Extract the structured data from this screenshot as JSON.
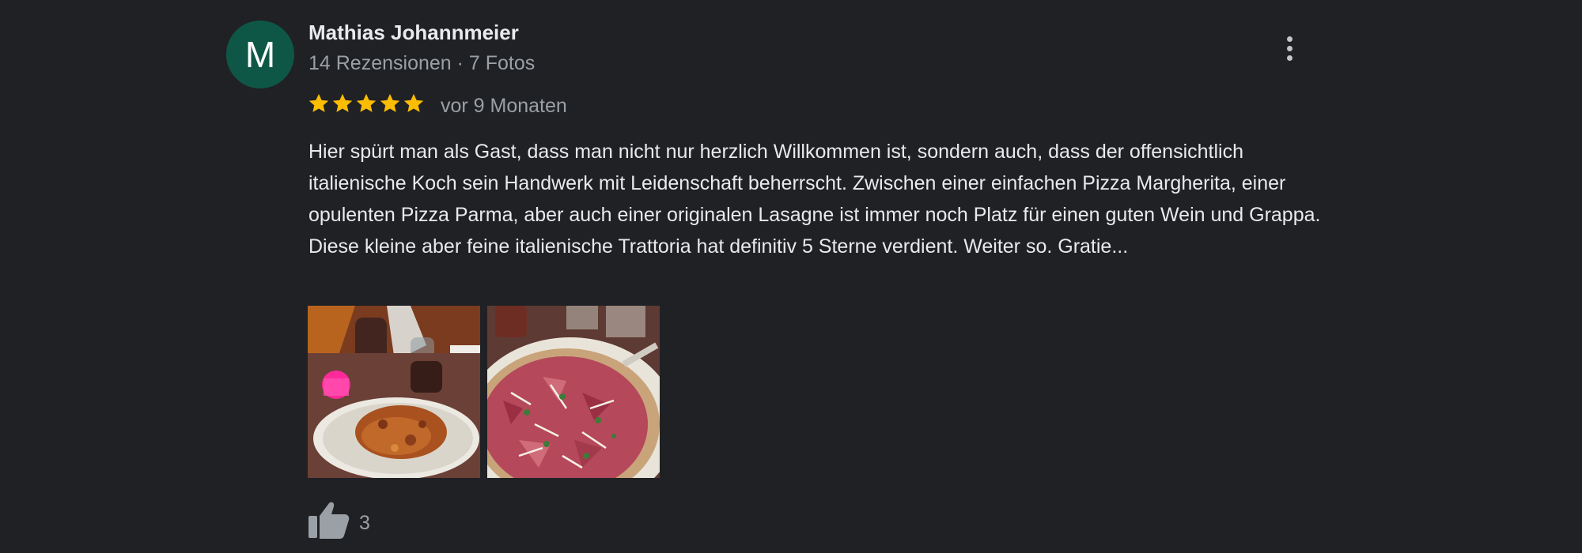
{
  "review": {
    "avatar_letter": "M",
    "author": "Mathias Johannmeier",
    "meta": "14 Rezensionen · 7 Fotos",
    "rating": 5,
    "time": "vor 9 Monaten",
    "text_lines": [
      "Hier spürt man als Gast, dass man nicht nur herzlich Willkommen ist, sondern auch, dass der offensichtlich italienische Koch sein Handwerk mit Leidenschaft beherrscht. Zwischen einer einfachen Pizza Margherita, einer opulenten Pizza Parma, aber auch einer originalen Lasagne ist immer noch Platz für einen guten Wein und Grappa.",
      "Diese kleine aber feine italienische Trattoria hat definitiv 5 Sterne verdient. Weiter so. Gratie..."
    ],
    "photos": [
      {
        "subject": "lasagne-plate-photo"
      },
      {
        "subject": "pizza-parma-photo"
      }
    ],
    "likes": "3",
    "icons": {
      "more": "more-vert-icon",
      "like": "thumb-up-icon",
      "star": "star-icon"
    },
    "colors": {
      "background": "#202124",
      "avatar": "#0e5747",
      "star": "#fbbc04",
      "primary_text": "#e8eaed",
      "secondary_text": "#9aa0a6"
    }
  }
}
